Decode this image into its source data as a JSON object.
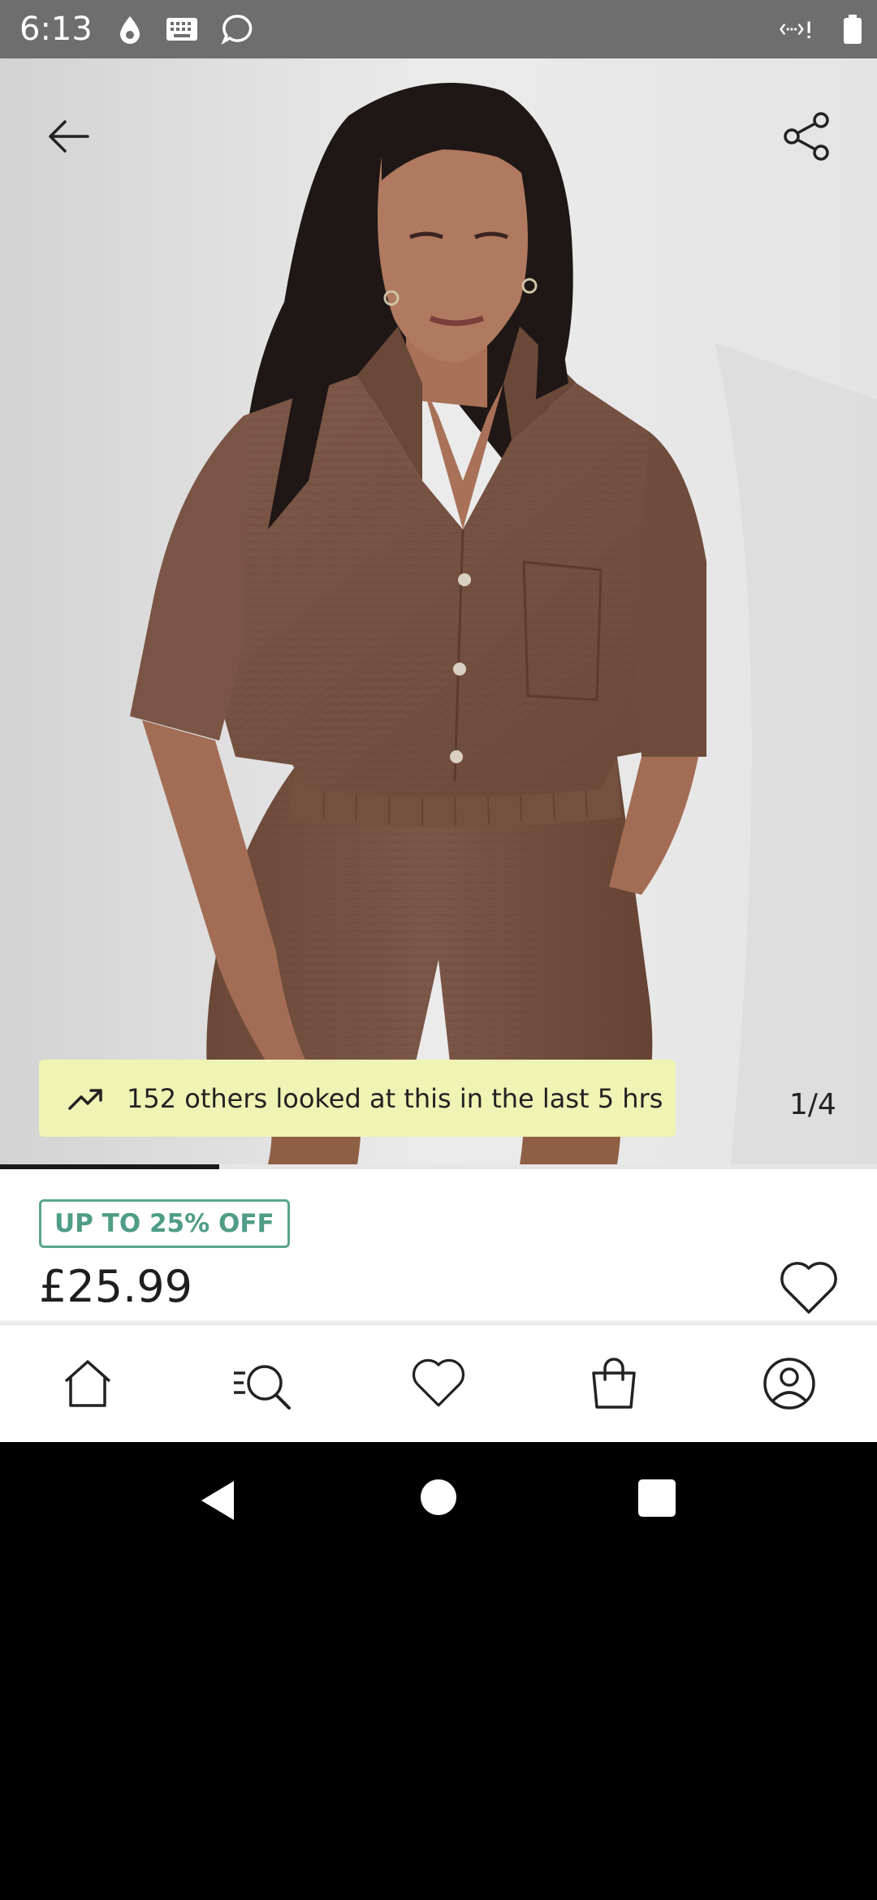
{
  "status_bar": {
    "time": "6:13",
    "icons": [
      "water-drop-icon",
      "keyboard-icon",
      "chat-bubble-icon",
      "data-saver-icon",
      "battery-icon"
    ]
  },
  "product": {
    "image_alt": "Model wearing brown cheesecloth shirt and shorts co-ord",
    "views_banner": "152 others looked at this in the last 5 hrs",
    "image_counter": "1/4",
    "carousel_progress": 0.25,
    "promo_badge": "UP TO 25% OFF",
    "price": "£25.99"
  },
  "icons": {
    "back": "arrow-left-icon",
    "share": "share-icon",
    "trend": "trending-up-icon",
    "wishlist": "heart-icon"
  },
  "bottom_nav": {
    "items": [
      "home-icon",
      "search-icon",
      "wishlist-heart-icon",
      "bag-icon",
      "account-icon"
    ]
  },
  "system_nav": {
    "items": [
      "back-triangle",
      "home-circle",
      "recents-square"
    ]
  },
  "colors": {
    "banner_bg": "#eff3b3",
    "promo_green": "#4f9d86",
    "status_bar": "#6e6e6e",
    "fabric_brown": "#7a5646"
  }
}
